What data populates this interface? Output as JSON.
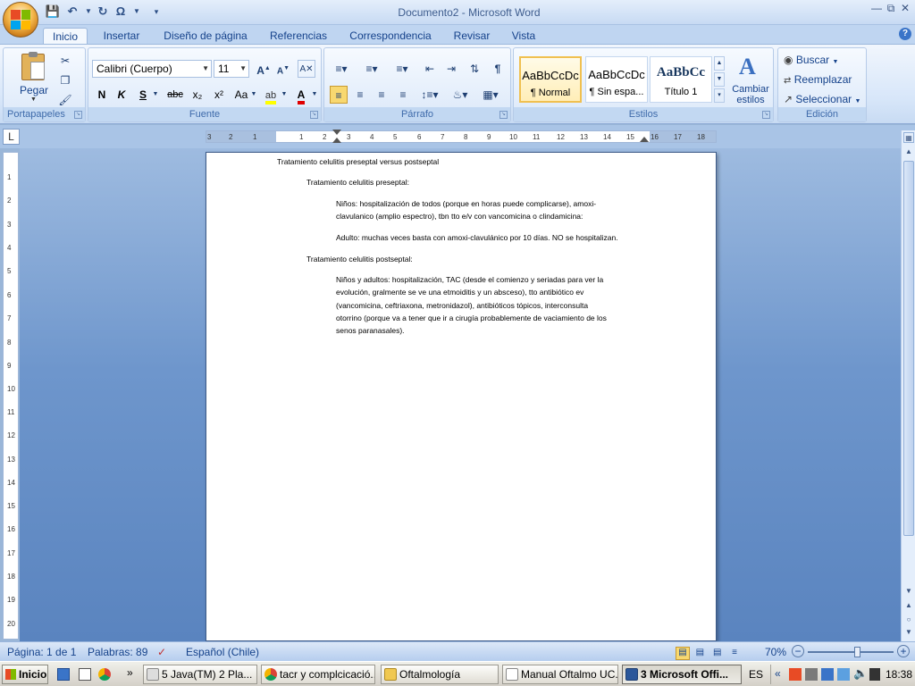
{
  "window": {
    "title": "Documento2 - Microsoft Word"
  },
  "tabs": [
    "Inicio",
    "Insertar",
    "Diseño de página",
    "Referencias",
    "Correspondencia",
    "Revisar",
    "Vista"
  ],
  "active_tab": "Inicio",
  "ribbon": {
    "portapapeles": {
      "label": "Portapapeles",
      "paste": "Pegar"
    },
    "fuente": {
      "label": "Fuente",
      "font_name": "Calibri (Cuerpo)",
      "font_size": "11",
      "bold": "N",
      "italic": "K",
      "underline": "S",
      "strike": "abc",
      "subscript": "x₂",
      "superscript": "x²",
      "change_case": "Aa"
    },
    "parrafo": {
      "label": "Párrafo"
    },
    "estilos": {
      "label": "Estilos",
      "styles": [
        {
          "preview": "AaBbCcDc",
          "name": "¶ Normal"
        },
        {
          "preview": "AaBbCcDc",
          "name": "¶ Sin espa..."
        },
        {
          "preview": "AaBbCc",
          "name": "Título 1"
        }
      ],
      "change_styles": "Cambiar estilos"
    },
    "edicion": {
      "label": "Edición",
      "find": "Buscar",
      "replace": "Reemplazar",
      "select": "Seleccionar"
    }
  },
  "ruler": {
    "h_ticks": [
      "3",
      "2",
      "1",
      "1",
      "2",
      "3",
      "4",
      "5",
      "6",
      "7",
      "8",
      "9",
      "10",
      "11",
      "12",
      "13",
      "14",
      "15",
      "16",
      "17",
      "18"
    ],
    "v_ticks": [
      "1",
      "2",
      "3",
      "4",
      "5",
      "6",
      "7",
      "8",
      "9",
      "10",
      "11",
      "12",
      "13",
      "14",
      "15",
      "16",
      "17",
      "18",
      "19",
      "20"
    ]
  },
  "document": {
    "title": "Tratamiento celulitis  preseptal versus postseptal",
    "h1": "Tratamiento celulitis  preseptal:",
    "p1a": "Niños: hospitalización  de todos (porque en horas puede complicarse),  amoxi-",
    "p1b": "clavulanico (amplio espectro),  tbn tto e/v con vancomicina  o clindamicina:",
    "p2": "Adulto: muchas veces basta con amoxi-clavulánico  por 10 días. NO se hospitalizan.",
    "h2": "Tratamiento celulitis  postseptal:",
    "p3a": "Niños y adultos:  hospitalización,  TAC (desde el comienzo  y seriadas para ver la",
    "p3b": "evolución, gralmente se ve una etmoiditis  y un absceso), tto antibiótico  ev",
    "p3c": "(vancomicina, ceftriaxona, metronidazol), antibióticos  tópicos,  interconsulta",
    "p3d": "otorrino (porque va a tener que ir a cirugía probablemente  de vaciamiento  de los",
    "p3e": "senos paranasales)."
  },
  "status": {
    "page": "Página: 1 de 1",
    "words": "Palabras: 89",
    "language": "Español (Chile)",
    "zoom": "70%",
    "zoom_level": 0.58
  },
  "taskbar": {
    "start": "Inicio",
    "tasks": [
      "5 Java(TM) 2 Pla...",
      "tacr y complcicació...",
      "Oftalmología",
      "Manual Oftalmo UC...",
      "3 Microsoft Offi..."
    ],
    "lang": "ES",
    "time": "18:38"
  },
  "colors": {
    "ribbon_text": "#15428b",
    "accent_blue": "#2b579a",
    "selected_style": "#f0c050"
  }
}
